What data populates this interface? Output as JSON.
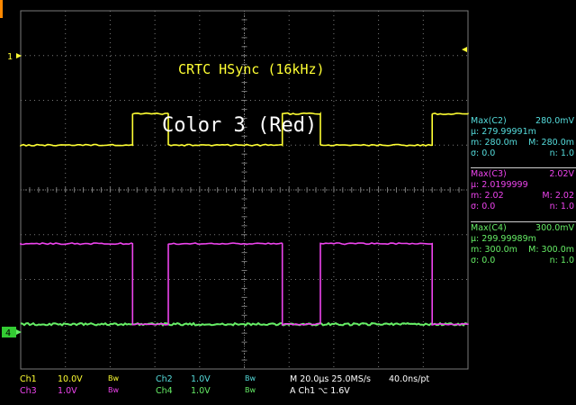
{
  "colors": {
    "ch1": "#ffff33",
    "ch2": "#55dddd",
    "ch3": "#ee44ee",
    "ch4": "#66ee66",
    "grid": "#7a7a7a",
    "background": "#000000",
    "trigger": "#ff8800"
  },
  "markers": {
    "ch1": "1",
    "ch4": "4"
  },
  "annotations": {
    "hsync": "CRTC HSync (16kHz)",
    "color": "Color 3 (Red)"
  },
  "measurements": [
    {
      "name": "Max(C2)",
      "value": "280.0mV",
      "mu": "μ: 279.99991m",
      "m": "m: 280.0m",
      "M": "M: 280.0m",
      "sigma": "σ: 0.0",
      "n": "n: 1.0"
    },
    {
      "name": "Max(C3)",
      "value": "2.02V",
      "mu": "μ: 2.0199999",
      "m": "m: 2.02",
      "M": "M: 2.02",
      "sigma": "σ: 0.0",
      "n": "n: 1.0"
    },
    {
      "name": "Max(C4)",
      "value": "300.0mV",
      "mu": "μ: 299.99989m",
      "m": "m: 300.0m",
      "M": "M: 300.0m",
      "sigma": "σ: 0.0",
      "n": "n: 1.0"
    }
  ],
  "status": {
    "ch1_label": "Ch1",
    "ch1_scale": "10.0V",
    "ch1_bw": "Bw",
    "ch2_label": "Ch2",
    "ch2_scale": "1.0V",
    "ch2_bw": "Bw",
    "ch3_label": "Ch3",
    "ch3_scale": "1.0V",
    "ch3_bw": "Bw",
    "ch4_label": "Ch4",
    "ch4_scale": "1.0V",
    "ch4_bw": "Bw",
    "timebase": "M 20.0μs 25.0MS/s",
    "sample": "40.0ns/pt",
    "trigger": "A Ch1 ⌥ 1.6V"
  },
  "waveforms": {
    "ch1_transitions_us": [
      50,
      66,
      117,
      134,
      184,
      200
    ],
    "ch3_transitions_us": [
      0,
      50,
      66,
      117,
      134,
      184,
      200
    ],
    "ch1_low_div": -1.0,
    "ch1_high_div": -1.7,
    "ch3_low_div": 3.0,
    "ch3_high_div": 1.2,
    "ch4_div": 3.0
  }
}
